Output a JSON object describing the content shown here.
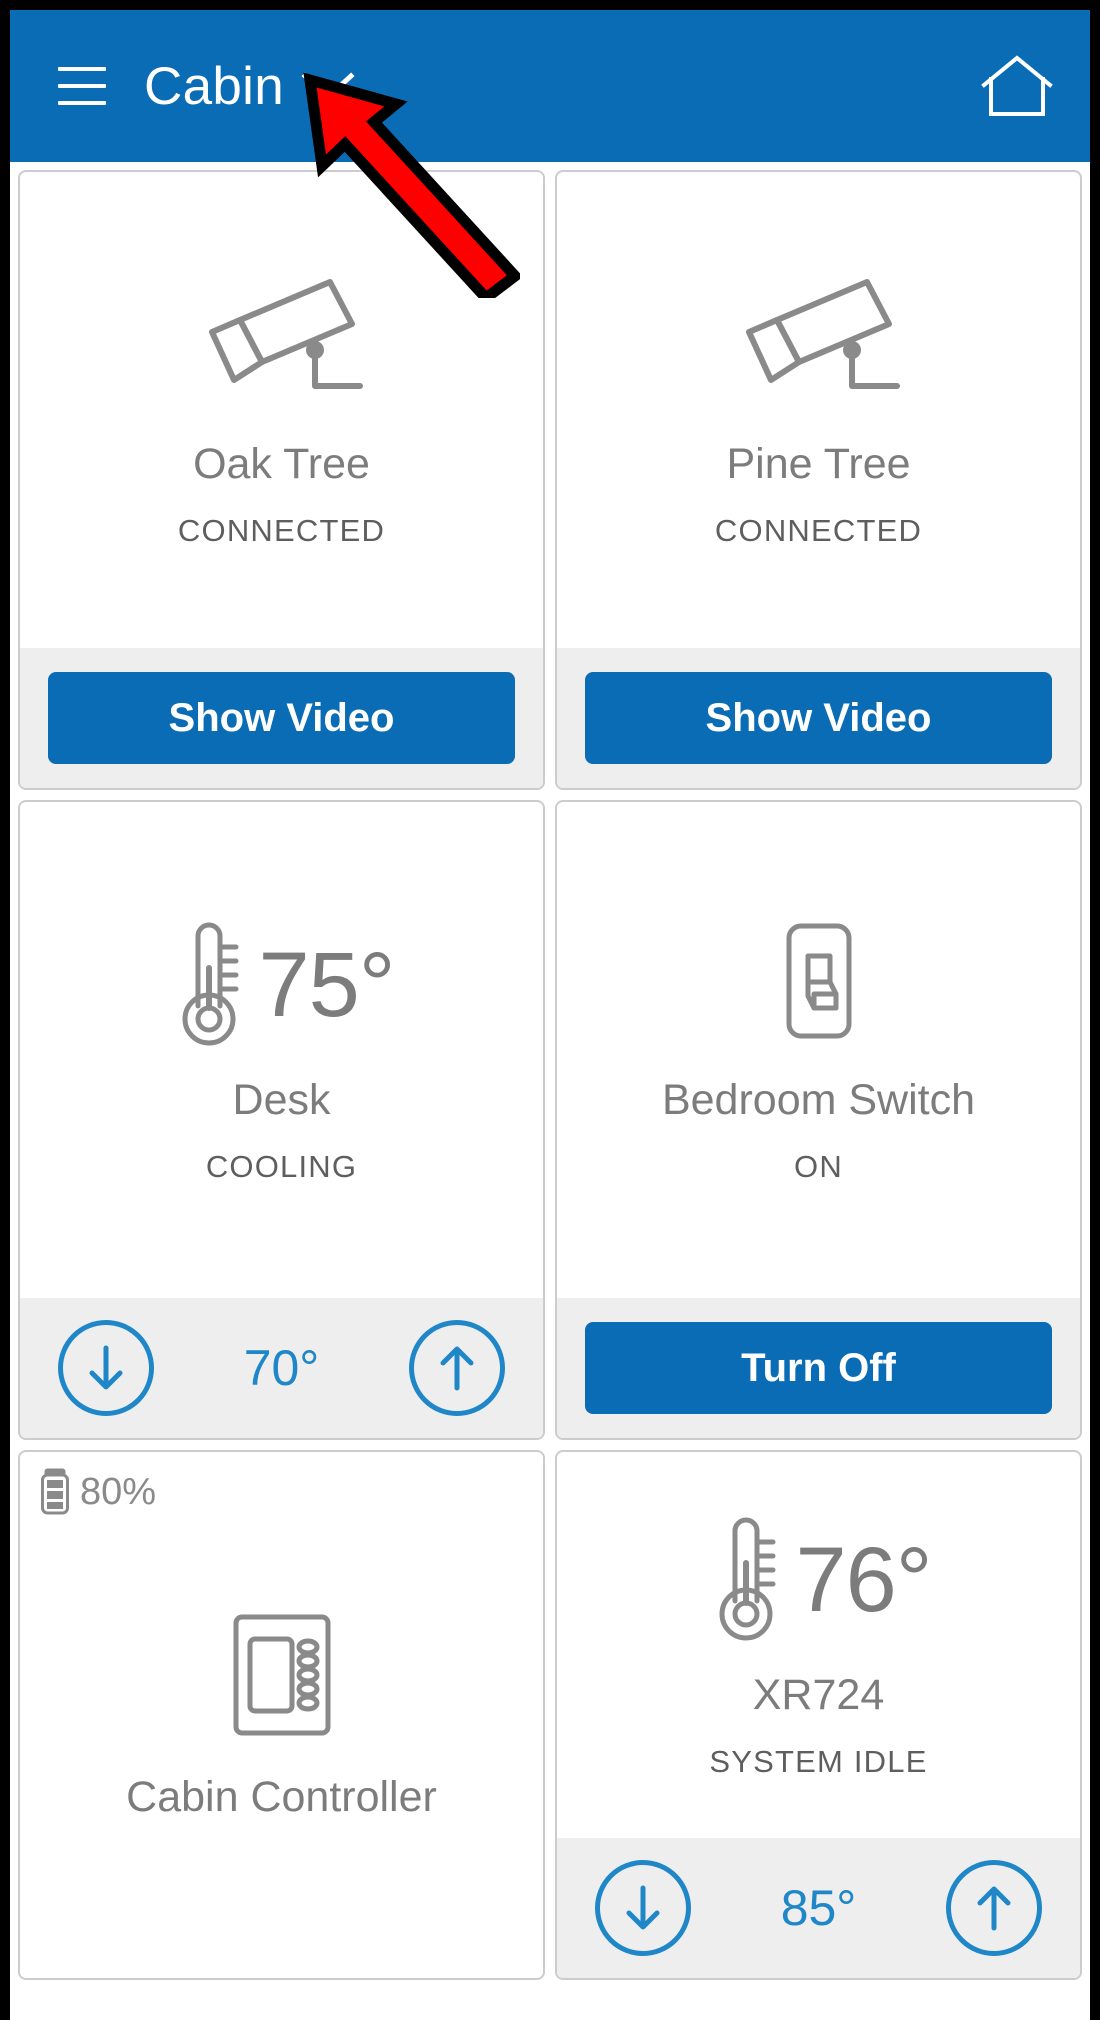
{
  "header": {
    "menu_icon": "hamburger-menu-icon",
    "location_label": "Cabin",
    "dropdown_icon": "chevron-down-icon",
    "home_icon": "home-icon"
  },
  "colors": {
    "primary_blue": "#0a6cb4",
    "accent_blue": "#1f87c8",
    "card_border": "#cccccc",
    "footer_bg": "#eeeeee",
    "text_gray": "#7c7c7c",
    "status_gray": "#5e5e5e",
    "annotation_red": "#ff0000"
  },
  "cards": [
    {
      "id": "oak-tree",
      "icon": "cctv-camera-icon",
      "title": "Oak Tree",
      "status": "CONNECTED",
      "action_label": "Show Video"
    },
    {
      "id": "pine-tree",
      "icon": "cctv-camera-icon",
      "title": "Pine Tree",
      "status": "CONNECTED",
      "action_label": "Show Video"
    },
    {
      "id": "desk-thermostat",
      "icon": "thermometer-icon",
      "temperature": "75°",
      "title": "Desk",
      "status": "COOLING",
      "setpoint": "70°",
      "decrease_icon": "arrow-down-icon",
      "increase_icon": "arrow-up-icon"
    },
    {
      "id": "bedroom-switch",
      "icon": "light-switch-icon",
      "title": "Bedroom Switch",
      "status": "ON",
      "action_label": "Turn Off"
    },
    {
      "id": "cabin-controller",
      "icon": "controller-panel-icon",
      "battery_icon": "battery-icon",
      "battery_level": "80%",
      "title": "Cabin Controller"
    },
    {
      "id": "xr724-thermostat",
      "icon": "thermometer-icon",
      "temperature": "76°",
      "title": "XR724",
      "status": "SYSTEM IDLE",
      "setpoint": "85°",
      "decrease_icon": "arrow-down-icon",
      "increase_icon": "arrow-up-icon"
    }
  ],
  "annotation": {
    "type": "arrow",
    "icon": "red-arrow-pointer",
    "points_to": "Cabin"
  }
}
